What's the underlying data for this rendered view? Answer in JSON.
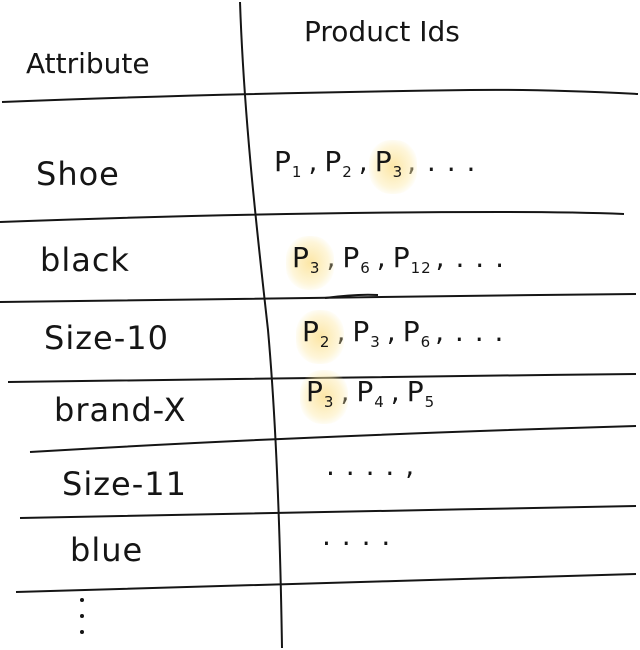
{
  "header": {
    "attribute_label": "Attribute",
    "ids_label": "Product Ids"
  },
  "rows": [
    {
      "attribute": "Shoe",
      "ids": [
        {
          "p": "P",
          "n": "1",
          "highlight": false
        },
        {
          "p": "P",
          "n": "2",
          "highlight": false
        },
        {
          "p": "P",
          "n": "3",
          "highlight": true
        }
      ],
      "trail": ", . . ."
    },
    {
      "attribute": "black",
      "ids": [
        {
          "p": "P",
          "n": "3",
          "highlight": true
        },
        {
          "p": "P",
          "n": "6",
          "highlight": false
        },
        {
          "p": "P",
          "n": "12",
          "highlight": false
        }
      ],
      "trail": ", . . ."
    },
    {
      "attribute": "Size-10",
      "ids": [
        {
          "p": "P",
          "n": "2",
          "highlight": true
        },
        {
          "p": "P",
          "n": "3",
          "highlight": false
        },
        {
          "p": "P",
          "n": "6",
          "highlight": false
        }
      ],
      "trail": ", . . ."
    },
    {
      "attribute": "brand-X",
      "ids": [
        {
          "p": "P",
          "n": "3",
          "highlight": true
        },
        {
          "p": "P",
          "n": "4",
          "highlight": false
        },
        {
          "p": "P",
          "n": "5",
          "highlight": false
        }
      ],
      "trail": ""
    },
    {
      "attribute": "Size-11",
      "ids": [],
      "trail": ". . . . ,"
    },
    {
      "attribute": "blue",
      "ids": [],
      "trail": ". . . ."
    }
  ],
  "colors": {
    "ink": "#151515",
    "highlight": "#fce296"
  }
}
